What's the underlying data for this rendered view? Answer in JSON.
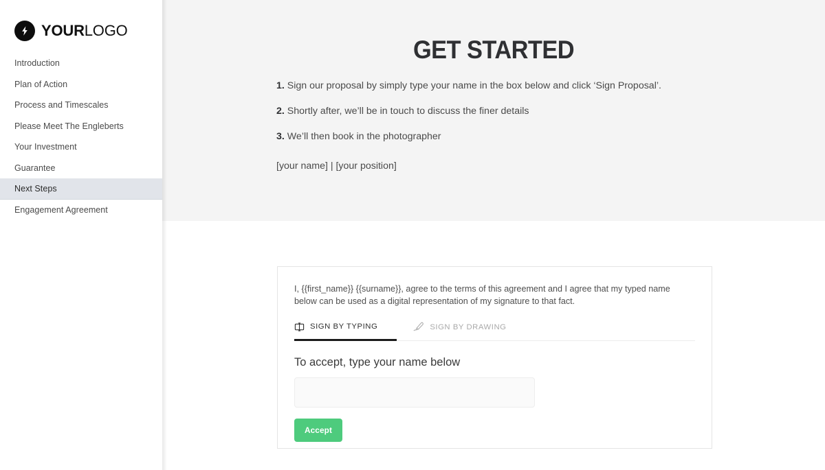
{
  "sidebar": {
    "logo": {
      "icon": "lightning-bolt-icon",
      "text_bold": "YOUR",
      "text_light": "LOGO"
    },
    "items": [
      {
        "label": "Introduction",
        "active": false
      },
      {
        "label": "Plan of Action",
        "active": false
      },
      {
        "label": "Process and Timescales",
        "active": false
      },
      {
        "label": "Please Meet The Engleberts",
        "active": false
      },
      {
        "label": "Your Investment",
        "active": false
      },
      {
        "label": "Guarantee",
        "active": false
      },
      {
        "label": "Next Steps",
        "active": true
      },
      {
        "label": "Engagement Agreement",
        "active": false
      }
    ]
  },
  "main": {
    "title": "GET STARTED",
    "steps": [
      {
        "num": "1.",
        "text": "Sign our proposal by simply type your name in the box below and click ‘Sign Proposal’."
      },
      {
        "num": "2.",
        "text": "Shortly after, we’ll be in touch to discuss the finer details"
      },
      {
        "num": "3.",
        "text": "We’ll then book in the photographer"
      }
    ],
    "signoff": "[your name] | [your position]"
  },
  "signature_card": {
    "consent_text": "I, {{first_name}} {{surname}}, agree to the terms of this agreement and I agree that my typed name below can be used as a digital representation of my signature to that fact.",
    "tabs": [
      {
        "label": "SIGN BY TYPING",
        "icon": "text-cursor-box-icon",
        "active": true
      },
      {
        "label": "SIGN BY DRAWING",
        "icon": "pen-nib-icon",
        "active": false
      }
    ],
    "accept_label": "To accept, type your name below",
    "name_input_value": "",
    "name_input_placeholder": "",
    "accept_button_label": "Accept"
  },
  "colors": {
    "accent_green": "#4ecb7d",
    "hero_background": "#f4f4f4",
    "active_nav_background": "#e1e4ea",
    "title_color": "#2f3033"
  }
}
